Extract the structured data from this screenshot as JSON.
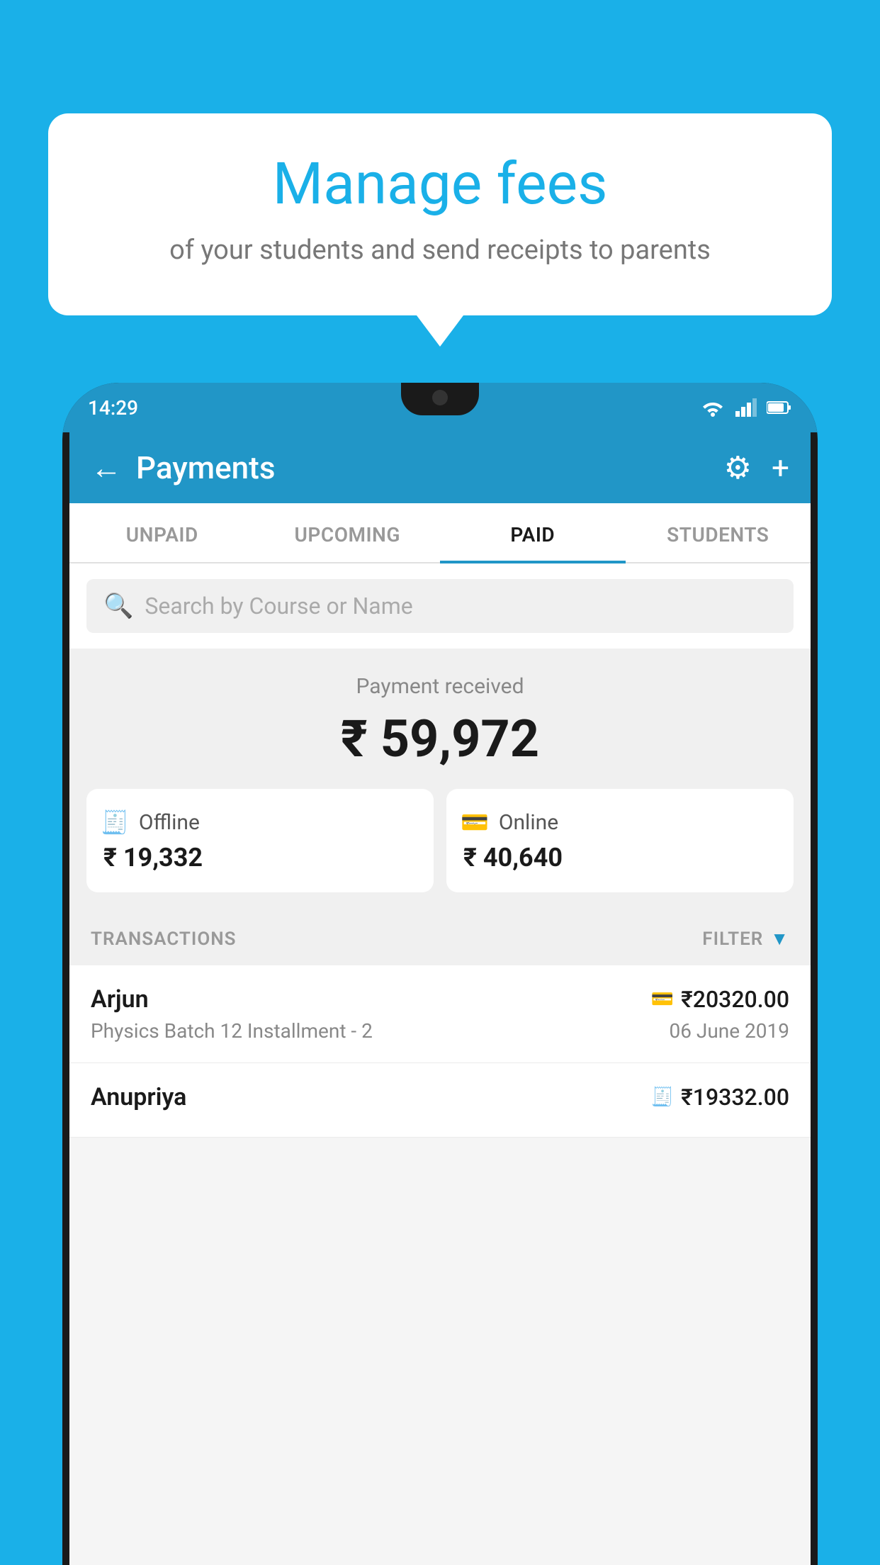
{
  "background_color": "#1ab0e8",
  "bubble": {
    "title": "Manage fees",
    "subtitle": "of your students and send receipts to parents"
  },
  "phone": {
    "time": "14:29",
    "header": {
      "title": "Payments",
      "back_label": "←",
      "settings_label": "⚙",
      "plus_label": "+"
    },
    "tabs": [
      {
        "label": "UNPAID",
        "active": false
      },
      {
        "label": "UPCOMING",
        "active": false
      },
      {
        "label": "PAID",
        "active": true
      },
      {
        "label": "STUDENTS",
        "active": false
      }
    ],
    "search": {
      "placeholder": "Search by Course or Name"
    },
    "summary": {
      "label": "Payment received",
      "amount": "₹ 59,972",
      "offline": {
        "label": "Offline",
        "amount": "₹ 19,332"
      },
      "online": {
        "label": "Online",
        "amount": "₹ 40,640"
      }
    },
    "transactions_label": "TRANSACTIONS",
    "filter_label": "FILTER",
    "transactions": [
      {
        "name": "Arjun",
        "amount": "₹20320.00",
        "course": "Physics Batch 12 Installment - 2",
        "date": "06 June 2019",
        "payment_type": "online"
      },
      {
        "name": "Anupriya",
        "amount": "₹19332.00",
        "course": "",
        "date": "",
        "payment_type": "offline"
      }
    ]
  }
}
